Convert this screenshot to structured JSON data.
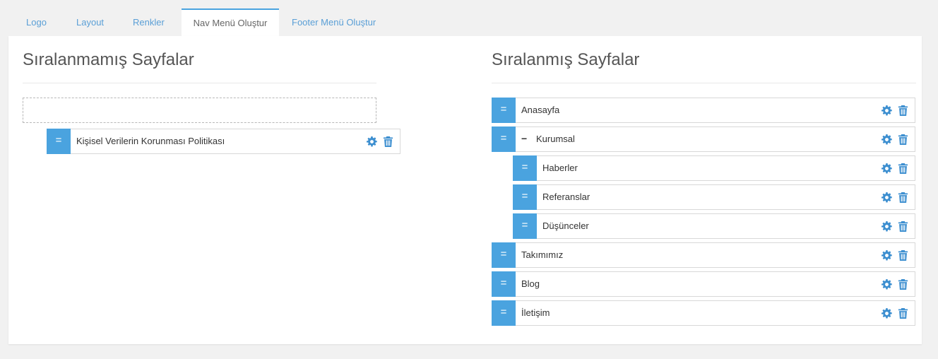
{
  "tabs": [
    {
      "label": "Logo"
    },
    {
      "label": "Layout"
    },
    {
      "label": "Renkler"
    },
    {
      "label": "Nav Menü Oluştur"
    },
    {
      "label": "Footer Menü Oluştur"
    }
  ],
  "left": {
    "title": "Sıralanmamış Sayfalar",
    "items": [
      {
        "label": "Kişisel Verilerin Korunması Politikası"
      }
    ]
  },
  "right": {
    "title": "Sıralanmış Sayfalar",
    "items": [
      {
        "label": "Anasayfa"
      },
      {
        "label": "Kurumsal",
        "collapse": "−"
      },
      {
        "label": "Haberler"
      },
      {
        "label": "Referanslar"
      },
      {
        "label": "Düşünceler"
      },
      {
        "label": "Takımımız"
      },
      {
        "label": "Blog"
      },
      {
        "label": "İletişim"
      }
    ]
  },
  "icons": {
    "handle": "=",
    "settings": "gear-icon",
    "delete": "trash-icon"
  },
  "colors": {
    "accent": "#4aa3df",
    "icon": "#3d8fd0",
    "tab_link": "#5a9fd6"
  }
}
